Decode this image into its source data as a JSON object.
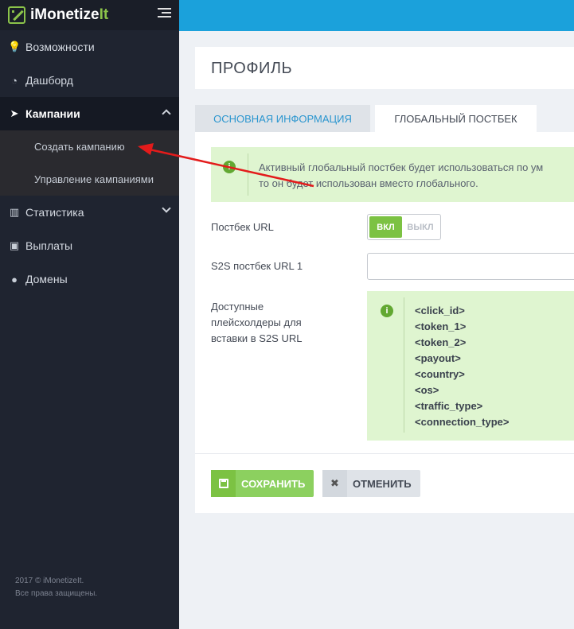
{
  "brand": {
    "name_main": "iMonetize",
    "name_accent": "It"
  },
  "sidebar": {
    "items": [
      {
        "label": "Возможности",
        "icon": "lightbulb-icon"
      },
      {
        "label": "Дашборд",
        "icon": "dashboard-icon"
      },
      {
        "label": "Кампании",
        "icon": "paper-plane-icon"
      },
      {
        "label": "Статистика",
        "icon": "bar-chart-icon"
      },
      {
        "label": "Выплаты",
        "icon": "money-icon"
      },
      {
        "label": "Домены",
        "icon": "globe-icon"
      }
    ],
    "subitems": [
      {
        "label": "Создать кампанию"
      },
      {
        "label": "Управление кампаниями"
      }
    ],
    "footer_line1": "2017 © iMonetizeIt.",
    "footer_line2": "Все права защищены."
  },
  "page": {
    "title": "ПРОФИЛЬ"
  },
  "tabs": [
    {
      "label": "ОСНОВНАЯ ИНФОРМАЦИЯ"
    },
    {
      "label": "ГЛОБАЛЬНЫЙ ПОСТБЕК"
    }
  ],
  "alert": {
    "line1": "Активный глобальный постбек будет использоваться по ум",
    "line2": "то он будет использован вместо глобального."
  },
  "form": {
    "postback_label": "Постбек URL",
    "toggle_on": "ВКЛ",
    "toggle_off": "ВЫКЛ",
    "s2s_label": "S2S постбек URL 1",
    "s2s_value": "",
    "placeholders_label_1": "Доступные",
    "placeholders_label_2": "плейсхолдеры для",
    "placeholders_label_3": "вставки в S2S URL",
    "placeholders": [
      "<click_id>",
      "<token_1>",
      "<token_2>",
      "<payout>",
      "<country>",
      "<os>",
      "<traffic_type>",
      "<connection_type>"
    ]
  },
  "buttons": {
    "save": "СОХРАНИТЬ",
    "cancel": "ОТМЕНИТЬ"
  },
  "colors": {
    "accent": "#1ba1db",
    "green": "#7cc243",
    "sidebar": "#1f2430",
    "annotation_arrow": "#e31b1b"
  }
}
